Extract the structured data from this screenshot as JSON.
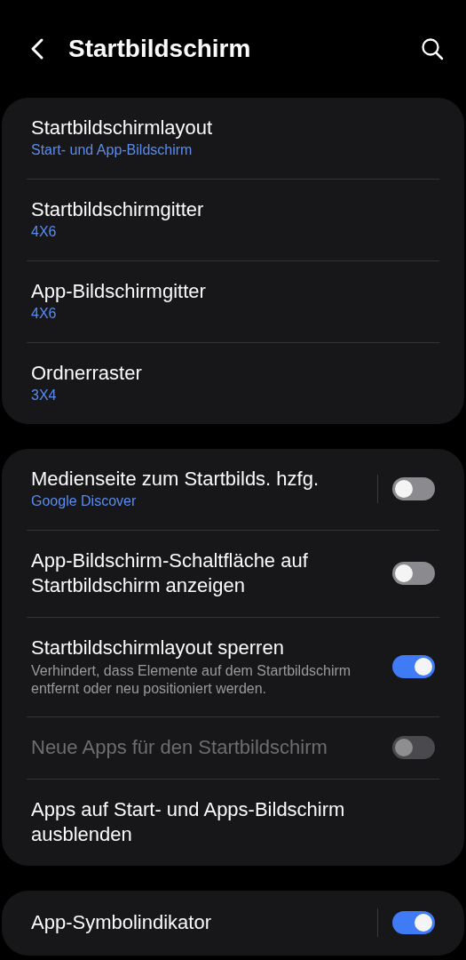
{
  "header": {
    "title": "Startbildschirm"
  },
  "groups": [
    {
      "items": [
        {
          "kind": "link",
          "title": "Startbildschirmlayout",
          "value": "Start- und App-Bildschirm"
        },
        {
          "kind": "link",
          "title": "Startbildschirmgitter",
          "value": "4X6"
        },
        {
          "kind": "link",
          "title": "App-Bildschirmgitter",
          "value": "4X6"
        },
        {
          "kind": "link",
          "title": "Ordnerraster",
          "value": "3X4"
        }
      ]
    },
    {
      "items": [
        {
          "kind": "switch",
          "title": "Medienseite zum Startbilds. hzfg.",
          "value": "Google Discover",
          "on": false,
          "disabled": false,
          "split": true
        },
        {
          "kind": "switch",
          "title": "App-Bildschirm-Schaltfläche auf Startbildschirm anzeigen",
          "on": false,
          "disabled": false,
          "split": false
        },
        {
          "kind": "switch",
          "title": "Startbildschirmlayout sperren",
          "description": "Verhindert, dass Elemente auf dem Startbildschirm entfernt oder neu positioniert werden.",
          "on": true,
          "disabled": false,
          "split": false
        },
        {
          "kind": "switch",
          "title": "Neue Apps für den Startbildschirm",
          "on": false,
          "disabled": true,
          "split": false
        },
        {
          "kind": "link",
          "title": "Apps auf Start- und Apps-Bildschirm ausblenden"
        }
      ]
    },
    {
      "items": [
        {
          "kind": "switch",
          "title": "App-Symbolindikator",
          "on": true,
          "disabled": false,
          "split": true
        }
      ]
    }
  ]
}
